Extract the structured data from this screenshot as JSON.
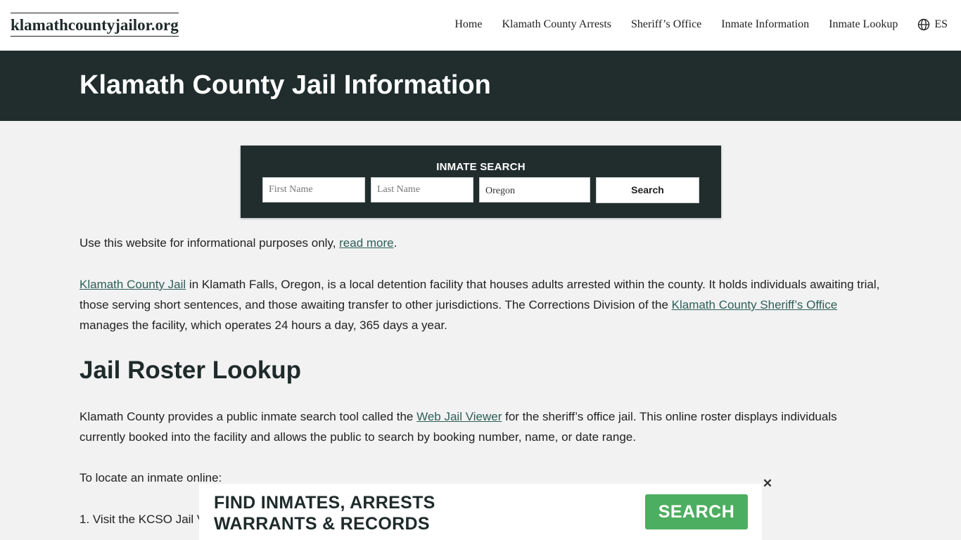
{
  "site": {
    "logo": "klamathcountyjailor.org"
  },
  "nav": {
    "items": [
      "Home",
      "Klamath County Arrests",
      "Sheriff’s Office",
      "Inmate Information",
      "Inmate Lookup"
    ],
    "lang": "ES"
  },
  "hero": {
    "title": "Klamath County Jail Information"
  },
  "search": {
    "title": "INMATE SEARCH",
    "first_placeholder": "First Name",
    "last_placeholder": "Last Name",
    "state_value": "Oregon",
    "button": "Search"
  },
  "content": {
    "p1_text": "Use this website for informational purposes only, ",
    "p1_link": "read more",
    "p1_end": ".",
    "p2_link1": "Klamath County Jail",
    "p2_text1": " in Klamath Falls, Oregon, is a local detention facility that houses adults arrested within the county. It holds individuals awaiting trial, those serving short sentences, and those awaiting transfer to other jurisdictions. The Corrections Division of the ",
    "p2_link2": "Klamath County Sheriff’s Office",
    "p2_text2": " manages the facility, which operates 24 hours a day, 365 days a year.",
    "h2": "Jail Roster Lookup",
    "p3_text1": "Klamath County provides a public inmate search tool called the ",
    "p3_link": "Web Jail Viewer",
    "p3_text2": " for the sheriff’s office jail. This online roster displays individuals currently booked into the facility and allows the public to search by booking number, name, or date range.",
    "p4": "To locate an inmate online:",
    "p5": "1. Visit the KCSO Jail V"
  },
  "ad": {
    "line1": "FIND INMATES, ARRESTS",
    "line2": "WARRANTS & RECORDS",
    "button": "SEARCH",
    "close": "✕"
  },
  "colors": {
    "dark": "#212d2d",
    "accent_green": "#4cae60",
    "link": "#2f5f58"
  },
  "icons": {
    "lang": "globe-icon",
    "close": "close-icon"
  }
}
